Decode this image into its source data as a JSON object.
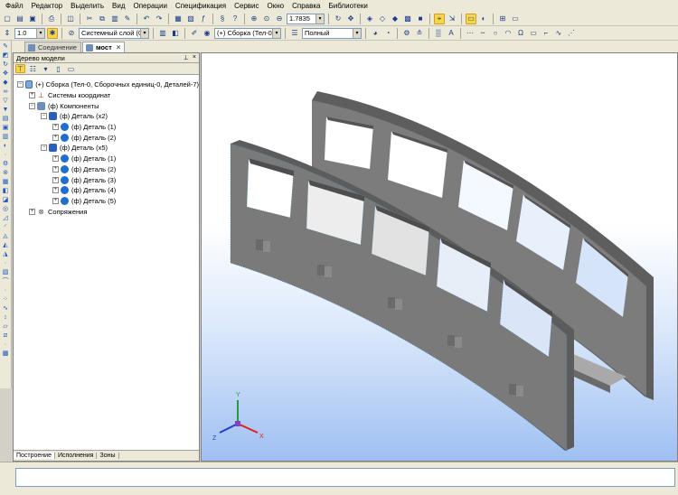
{
  "menu": [
    "Файл",
    "Редактор",
    "Выделить",
    "Вид",
    "Операции",
    "Спецификация",
    "Сервис",
    "Окно",
    "Справка",
    "Библиотеки"
  ],
  "toolbar": {
    "zoom_value": "1.7835",
    "step_value": "1.0",
    "layer_value": "Системный слой (0)",
    "assembly_value": "(+) Сборка (Тел-0, (",
    "display_mode_value": "Полный"
  },
  "tabs": [
    {
      "label": "Соединение",
      "active": false
    },
    {
      "label": "мост",
      "active": true
    }
  ],
  "tree_panel": {
    "title": "Дерево модели",
    "nodes": [
      {
        "label": "(+) Сборка (Тел-0, Сборочных единиц-0, Деталей-7)",
        "level": 0,
        "expander": "−",
        "icon": "assembly-icon"
      },
      {
        "label": "Системы координат",
        "level": 1,
        "expander": "+",
        "icon": "axes-icon"
      },
      {
        "label": "(ф) Компоненты",
        "level": 1,
        "expander": "−",
        "icon": "components-icon"
      },
      {
        "label": "(ф) Деталь (x2)",
        "level": 2,
        "expander": "−",
        "icon": "part-group-icon"
      },
      {
        "label": "(ф) Деталь (1)",
        "level": 3,
        "expander": "+",
        "icon": "part-icon"
      },
      {
        "label": "(ф) Деталь (2)",
        "level": 3,
        "expander": "+",
        "icon": "part-icon"
      },
      {
        "label": "(ф) Деталь (x5)",
        "level": 2,
        "expander": "−",
        "icon": "part-group-icon"
      },
      {
        "label": "(ф) Деталь (1)",
        "level": 3,
        "expander": "+",
        "icon": "part-icon"
      },
      {
        "label": "(ф) Деталь (2)",
        "level": 3,
        "expander": "+",
        "icon": "part-icon"
      },
      {
        "label": "(ф) Деталь (3)",
        "level": 3,
        "expander": "+",
        "icon": "part-icon"
      },
      {
        "label": "(ф) Деталь (4)",
        "level": 3,
        "expander": "+",
        "icon": "part-icon"
      },
      {
        "label": "(ф) Деталь (5)",
        "level": 3,
        "expander": "+",
        "icon": "part-icon"
      },
      {
        "label": "Сопряжения",
        "level": 1,
        "expander": "+",
        "icon": "mates-icon"
      }
    ],
    "bottom_tabs": [
      "Построение",
      "Исполнения",
      "Зоны"
    ]
  },
  "viewport": {
    "axis_labels": {
      "x": "X",
      "y": "Y",
      "z": "Z"
    }
  },
  "colors": {
    "part_face": "#7a7a7a",
    "part_top": "#a9a9a9",
    "part_dark": "#5c5c5c",
    "axis_x": "#e0201c",
    "axis_y": "#20a030",
    "axis_z": "#2040d0"
  }
}
